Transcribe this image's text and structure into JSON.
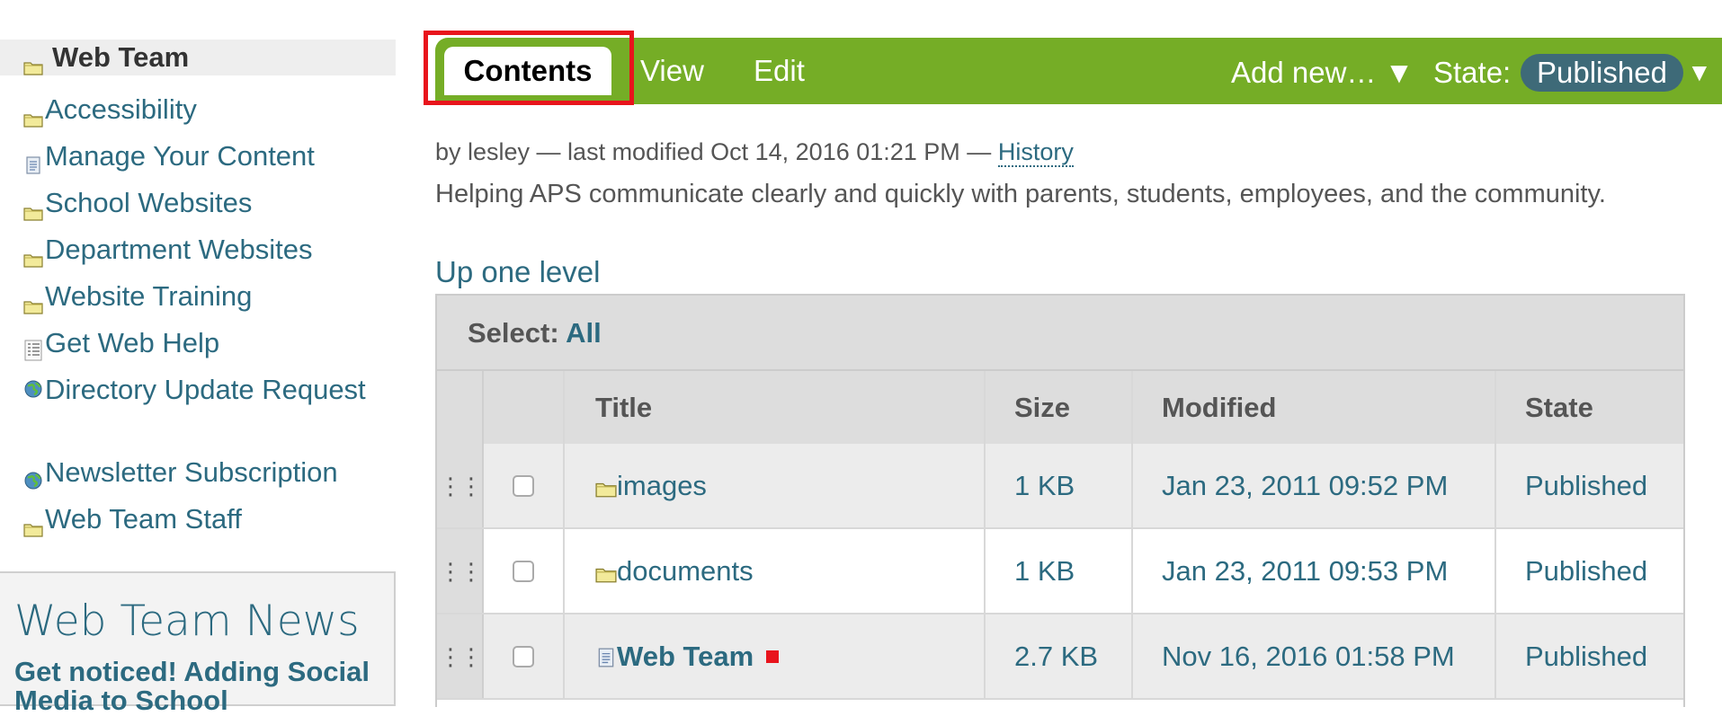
{
  "sidebar": {
    "items": [
      {
        "label": "Web Team",
        "icon": "folder-icon",
        "current": true
      },
      {
        "label": "Accessibility",
        "icon": "folder-icon"
      },
      {
        "label": "Manage Your Content",
        "icon": "document-icon"
      },
      {
        "label": "School Websites",
        "icon": "folder-icon"
      },
      {
        "label": "Department Websites",
        "icon": "folder-icon"
      },
      {
        "label": "Website Training",
        "icon": "folder-icon"
      },
      {
        "label": "Get Web Help",
        "icon": "form-icon"
      },
      {
        "label": "Directory Update Request",
        "icon": "globe-link-icon"
      },
      {
        "label": "Newsletter Subscription",
        "icon": "globe-link-icon"
      },
      {
        "label": "Web Team Staff",
        "icon": "folder-icon"
      }
    ],
    "news": {
      "title": "Web Team News",
      "item": "Get noticed! Adding Social Media to School"
    }
  },
  "toolbar": {
    "tabs": {
      "contents": "Contents",
      "view": "View",
      "edit": "Edit"
    },
    "add_new": "Add new… ▼",
    "state_label": "State:",
    "state_value": "Published",
    "state_arrow": "▼",
    "color": "#75ad26",
    "highlight_color": "#e8141c"
  },
  "byline": {
    "prefix": "by lesley — last modified Oct 14, 2016 01:21 PM —",
    "history_link": "History"
  },
  "description": "Helping APS communicate clearly and quickly with parents, students, employees, and the community.",
  "up_one_level": "Up one level",
  "listing": {
    "select_label": "Select:",
    "select_all": "All",
    "columns": {
      "title": "Title",
      "size": "Size",
      "modified": "Modified",
      "state": "State"
    },
    "rows": [
      {
        "icon": "folder-icon",
        "title": "images",
        "size": "1 KB",
        "modified": "Jan 23, 2011 09:52 PM",
        "state": "Published"
      },
      {
        "icon": "folder-icon",
        "title": "documents",
        "size": "1 KB",
        "modified": "Jan 23, 2011 09:53 PM",
        "state": "Published"
      },
      {
        "icon": "document-icon",
        "title": "Web Team",
        "size": "2.7 KB",
        "modified": "Nov 16, 2016 01:58 PM",
        "state": "Published",
        "default_page_marker": true
      }
    ]
  }
}
